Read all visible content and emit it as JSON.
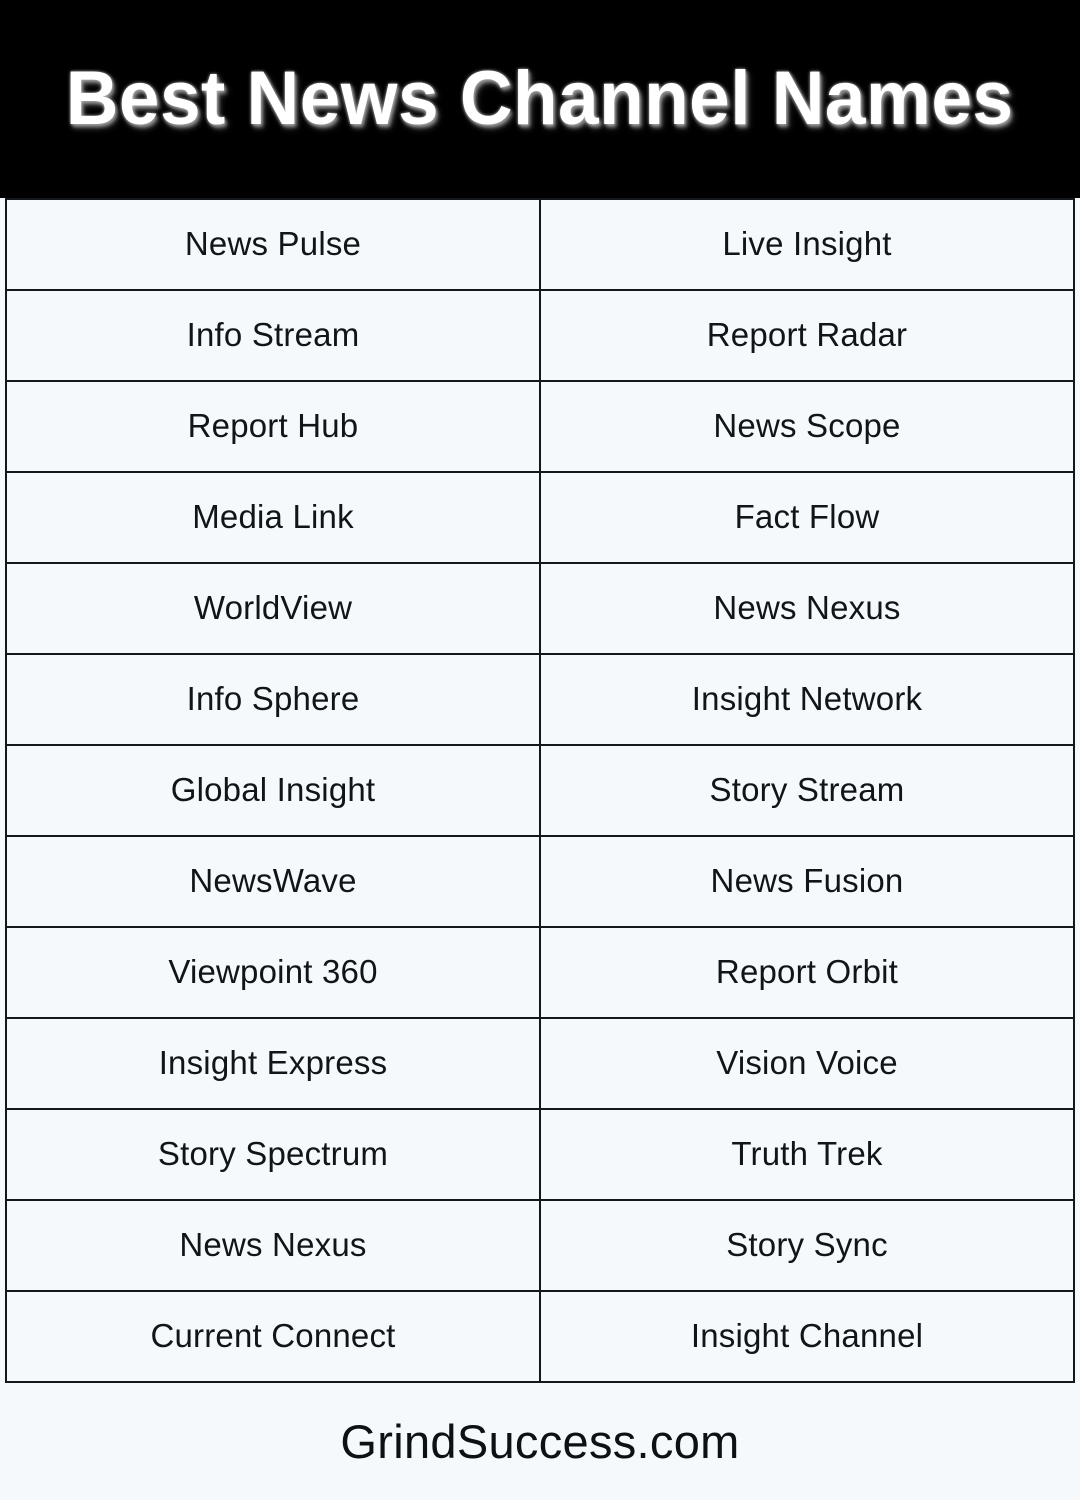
{
  "header": {
    "title": "Best News Channel Names",
    "background_color": "#000000",
    "text_color": "#ffffff"
  },
  "table": {
    "columns": 2,
    "cell_background": "#f5f9fb",
    "border_color": "#14171c",
    "text_color": "#111418",
    "rows": [
      {
        "left": "News Pulse",
        "right": "Live Insight"
      },
      {
        "left": "Info Stream",
        "right": "Report Radar"
      },
      {
        "left": "Report Hub",
        "right": "News Scope"
      },
      {
        "left": "Media Link",
        "right": "Fact Flow"
      },
      {
        "left": "WorldView",
        "right": "News Nexus"
      },
      {
        "left": "Info Sphere",
        "right": "Insight Network"
      },
      {
        "left": "Global Insight",
        "right": "Story Stream"
      },
      {
        "left": "NewsWave",
        "right": "News Fusion"
      },
      {
        "left": "Viewpoint 360",
        "right": "Report Orbit"
      },
      {
        "left": "Insight Express",
        "right": "Vision Voice"
      },
      {
        "left": "Story Spectrum",
        "right": "Truth Trek"
      },
      {
        "left": "News Nexus",
        "right": "Story Sync"
      },
      {
        "left": "Current Connect",
        "right": "Insight Channel"
      }
    ]
  },
  "footer": {
    "site": "GrindSuccess.com"
  }
}
